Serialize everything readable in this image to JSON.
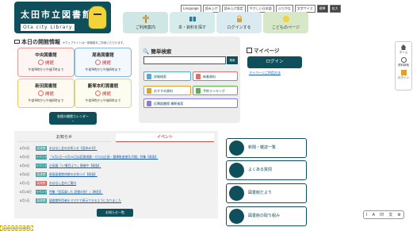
{
  "header": {
    "logo_ja": "太田市立図書館",
    "logo_en": "Ota city Library",
    "top_links": [
      "Language",
      "読み上げ",
      "読み上げ設定",
      "やさしい日本語",
      "ふりがな",
      "文字サイズ",
      "標準",
      "拡大"
    ],
    "nav": [
      {
        "label": "ご利用案内"
      },
      {
        "label": "本・資料を探す"
      },
      {
        "label": "ログインする"
      },
      {
        "label": "こどものページ"
      }
    ]
  },
  "today": {
    "title": "本日の開館情報",
    "note": "※ウェブサイトは一部機能をご利用いただけます。",
    "libraries": [
      {
        "name": "中央図書館",
        "status": "開館",
        "hours": "午前9時から午後7時まで"
      },
      {
        "name": "尾島図書館",
        "status": "開館",
        "hours": "午前9時から午後6時まで"
      },
      {
        "name": "新田図書館",
        "status": "開館",
        "hours": "午前9時から午後6時まで"
      },
      {
        "name": "藪塚本町図書館",
        "status": "開館",
        "hours": "午前9時から午後6時まで"
      }
    ],
    "calendar_button": "各館の開館カレンダー"
  },
  "search": {
    "title": "簡単検索",
    "button": "検索",
    "buttons": [
      "詳細検索",
      "新着資料",
      "おすすめ資料",
      "予約ランキング",
      "近隣図書館 横断検索"
    ]
  },
  "mypage": {
    "title": "マイページ",
    "login": "ログイン",
    "link": "マイページご利用方法"
  },
  "side": [
    "ホーム",
    "資料検索",
    "ログイン"
  ],
  "news": {
    "tabs": [
      "お知らせ",
      "イベント"
    ],
    "items": [
      {
        "date": "8月9日",
        "cat": "図書館",
        "title": "おはなし会のお知らせ【夏休み号】"
      },
      {
        "date": "8月9日",
        "cat": "イベント",
        "title": "「9月2日～9月30日は読書週間・ゼロ災企画・健康推進普及月間」特集【尾島】"
      },
      {
        "date": "8月8日",
        "cat": "イベント",
        "title": "企画展「27番目より」開催中【尾島】"
      },
      {
        "date": "8月8日",
        "cat": "図書館",
        "title": "尾島図書館休館のお知らせ【尾島】"
      },
      {
        "date": "8月1日",
        "cat": "図書館",
        "title": "おはなし会のご案内"
      },
      {
        "date": "8月28日",
        "cat": "イベント",
        "title": "特集「会話楽しむ 読書の秋！」【新田】"
      },
      {
        "date": "8月1日",
        "cat": "図書館",
        "title": "図書館利用者をスマホで表示できるようになりました"
      }
    ],
    "more": "お知らせ一覧"
  },
  "big_buttons": [
    "新聞・雑誌一覧",
    "よくある質問",
    "図書館だより",
    "図書館の取り組み"
  ],
  "tools": [
    "I",
    "A",
    "印",
    "文",
    "⚙"
  ],
  "url": "javascript:void(0);"
}
